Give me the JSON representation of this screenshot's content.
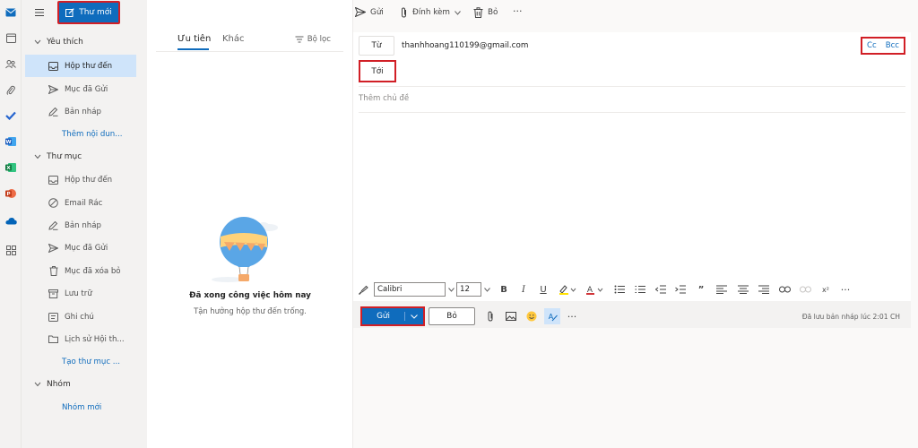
{
  "rail": {
    "icons": [
      "mail-icon",
      "calendar-icon",
      "people-icon",
      "attach-icon",
      "todo-icon",
      "word-icon",
      "excel-icon",
      "powerpoint-icon",
      "onedrive-icon",
      "apps-icon"
    ],
    "colors": {
      "mail": "#0f6cbd",
      "todo": "#2564cf",
      "word": "#185abd",
      "excel": "#107c41",
      "powerpoint": "#c43e1c",
      "onedrive": "#0364b8"
    }
  },
  "folders": {
    "new_mail_label": "Thư mới",
    "favorites_title": "Yêu thích",
    "favorites": [
      "Hộp thư đến",
      "Mục đã Gửi",
      "Bản nháp"
    ],
    "add_favorite": "Thêm nội dun...",
    "folders_title": "Thư mục",
    "items": [
      "Hộp thư đến",
      "Email Rác",
      "Bản nháp",
      "Mục đã Gửi",
      "Mục đã xóa bỏ",
      "Lưu trữ",
      "Ghi chú",
      "Lịch sử Hội th..."
    ],
    "create_folder": "Tạo thư mục ...",
    "groups_title": "Nhóm",
    "new_group": "Nhóm mới"
  },
  "list": {
    "tab_focused": "Ưu tiên",
    "tab_other": "Khác",
    "filter_label": "Bộ lọc",
    "empty_title": "Đã xong công việc hôm nay",
    "empty_subtitle": "Tận hưởng hộp thư đến trống."
  },
  "toolbar": {
    "send": "Gửi",
    "attach": "Đính kèm",
    "discard": "Bỏ",
    "more": "···"
  },
  "compose": {
    "from_label": "Từ",
    "from_address": "thanhhoang110199@gmail.com",
    "cc": "Cc",
    "bcc": "Bcc",
    "to_label": "Tới",
    "subject_placeholder": "Thêm chủ đề",
    "font": "Calibri",
    "font_size": "12",
    "send_label": "Gửi",
    "discard_label": "Bỏ",
    "saved_status": "Đã lưu bản nháp lúc 2:01 CH"
  },
  "colors": {
    "accent": "#0f6cbd",
    "highlight_box": "#d11f26",
    "selected": "#cfe4fa"
  }
}
